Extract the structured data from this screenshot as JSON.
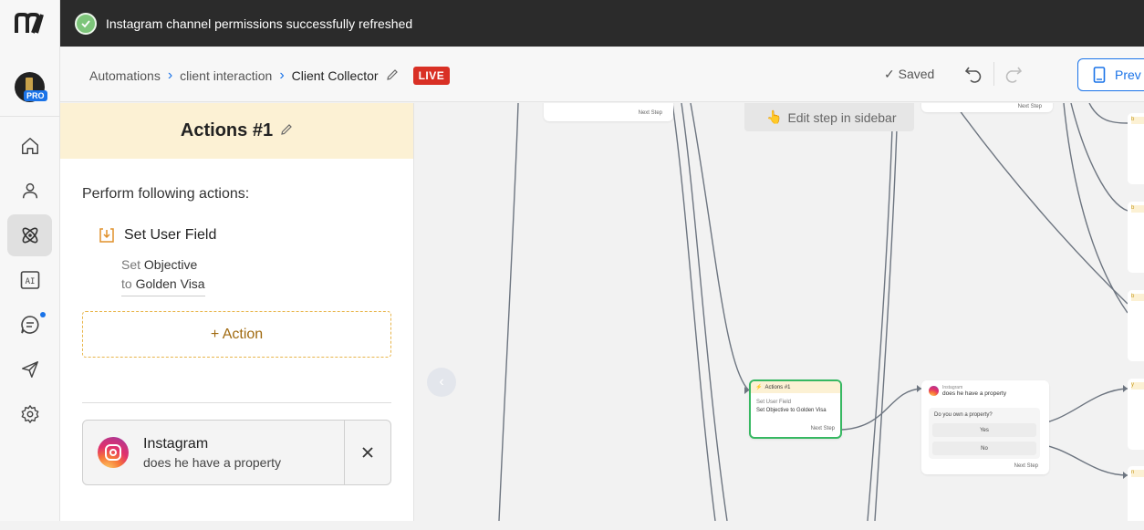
{
  "toast": {
    "message": "Instagram channel permissions successfully refreshed",
    "icon": "check-circle-icon",
    "color": "#7dc57a"
  },
  "rail": {
    "brand": "m",
    "pro_badge": "PRO",
    "items": [
      {
        "name": "home",
        "icon": "home-icon"
      },
      {
        "name": "contacts",
        "icon": "user-icon"
      },
      {
        "name": "automation",
        "icon": "atom-icon",
        "active": true
      },
      {
        "name": "ai",
        "icon": "ai-icon",
        "label": "AI"
      },
      {
        "name": "live-chat",
        "icon": "chat-icon",
        "notification": true
      },
      {
        "name": "broadcasting",
        "icon": "send-icon"
      },
      {
        "name": "settings",
        "icon": "gear-icon"
      }
    ]
  },
  "header": {
    "breadcrumbs": [
      "Automations",
      "client interaction",
      "Client Collector"
    ],
    "live_label": "LIVE",
    "saved_label": "Saved",
    "preview_label": "Prev"
  },
  "panel": {
    "title": "Actions #1",
    "perform_label": "Perform following actions:",
    "action": {
      "name": "Set User Field",
      "set_word": "Set",
      "field": "Objective",
      "to_word": "to",
      "value": "Golden Visa"
    },
    "add_action_label": "+ Action",
    "next_step": {
      "channel": "Instagram",
      "text": "does he have a property"
    }
  },
  "canvas": {
    "edit_hint": "Edit step in sidebar",
    "next_step_label": "Next Step",
    "action_node": {
      "title": "Actions #1",
      "line1": "Set User Field",
      "line2": "Set Objective to Golden Visa",
      "footer": "Next Step"
    },
    "ig_node": {
      "channel": "Instagram",
      "title": "does he have a property",
      "question": "Do you own a property?",
      "options": [
        "Yes",
        "No"
      ],
      "footer": "Next Step"
    },
    "right_node_labels": [
      "b",
      "b",
      "b",
      "y",
      "n"
    ]
  }
}
